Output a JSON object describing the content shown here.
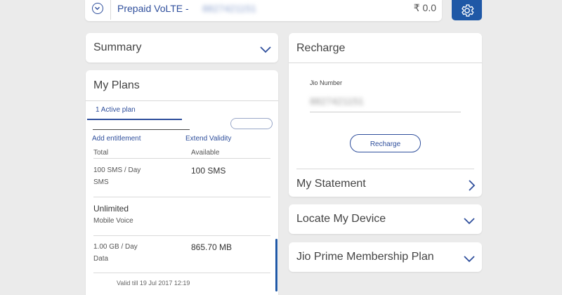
{
  "topbar": {
    "plan_name": "Prepaid VoLTE - ",
    "number_masked": "8827421151",
    "balance": "₹ 0.0"
  },
  "summary": {
    "title": "Summary"
  },
  "my_plans": {
    "title": "My Plans",
    "active_tab": "1 Active plan",
    "add_entitlement": "Add entitlement",
    "extend_validity": "Extend Validity",
    "col_total": "Total",
    "col_available": "Available",
    "rows": [
      {
        "total": "100 SMS / Day",
        "type": "SMS",
        "available": "100 SMS"
      },
      {
        "total": "Unlimited",
        "type": "Mobile Voice",
        "available": ""
      },
      {
        "total": "1.00 GB / Day",
        "type": "Data",
        "available": "865.70 MB"
      }
    ],
    "valid_till": "Valid till 19 Jul 2017 12:19"
  },
  "recharge": {
    "title": "Recharge",
    "number_label": "Jio Number",
    "number_value": "8827421151",
    "button": "Recharge"
  },
  "my_statement": {
    "title": "My Statement"
  },
  "locate_device": {
    "title": "Locate My Device"
  },
  "prime": {
    "title": "Jio Prime Membership Plan"
  },
  "colors": {
    "accent": "#1f58a6",
    "link": "#2f4f9c",
    "background": "#ebebeb"
  },
  "icons": [
    "chevron-down-circle-icon",
    "gear-icon",
    "chevron-down-icon",
    "chevron-right-icon"
  ]
}
